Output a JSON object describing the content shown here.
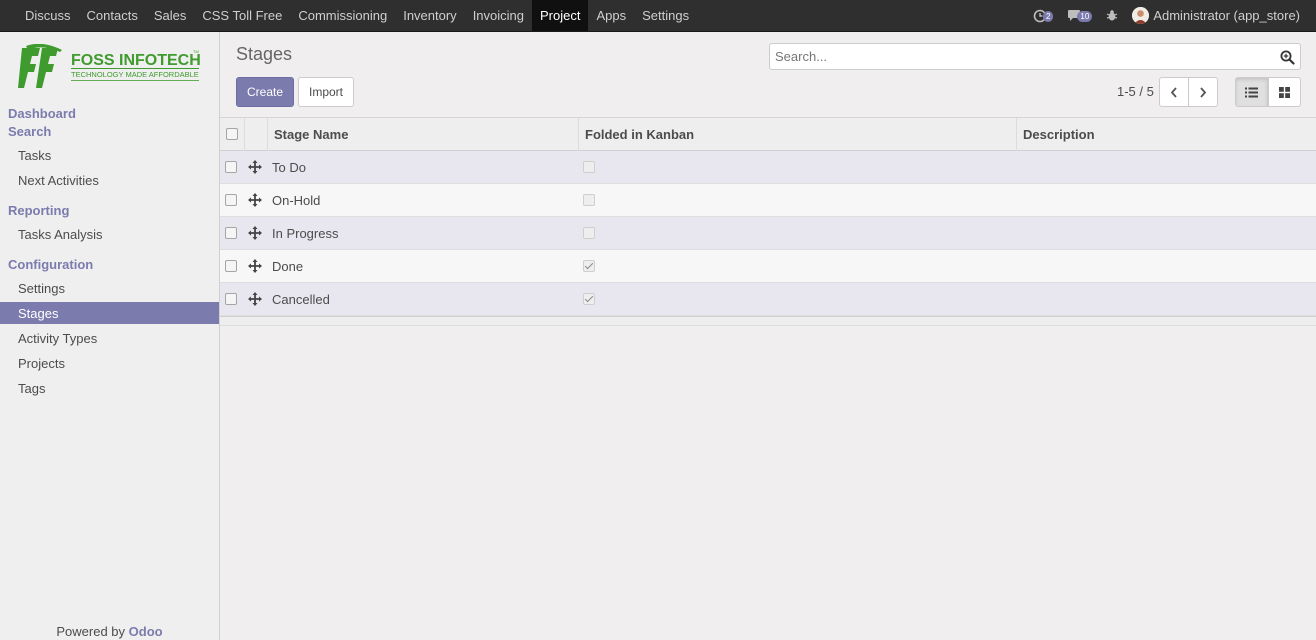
{
  "navbar": {
    "menus": [
      "Discuss",
      "Contacts",
      "Sales",
      "CSS Toll Free",
      "Commissioning",
      "Inventory",
      "Invoicing",
      "Project",
      "Apps",
      "Settings"
    ],
    "active_menu": "Project",
    "activity_count": "2",
    "message_count": "10",
    "user": "Administrator (app_store)"
  },
  "sidebar": {
    "logo_name": "FOSS INFOTECH",
    "logo_tagline": "TECHNOLOGY MADE AFFORDABLE",
    "logo_tm": "TM",
    "sections": [
      {
        "label": "Dashboard"
      },
      {
        "label": "Search",
        "items": [
          "Tasks",
          "Next Activities"
        ]
      },
      {
        "label": "Reporting",
        "items": [
          "Tasks Analysis"
        ]
      },
      {
        "label": "Configuration",
        "items": [
          "Settings",
          "Stages",
          "Activity Types",
          "Projects",
          "Tags"
        ]
      }
    ],
    "active_item": "Stages",
    "powered_prefix": "Powered by",
    "powered_brand": "Odoo"
  },
  "control_panel": {
    "title": "Stages",
    "search_placeholder": "Search...",
    "create_label": "Create",
    "import_label": "Import",
    "pager": "1-5 / 5",
    "active_view": "list"
  },
  "table": {
    "columns": [
      "Stage Name",
      "Folded in Kanban",
      "Description"
    ],
    "rows": [
      {
        "name": "To Do",
        "folded": false,
        "description": ""
      },
      {
        "name": "On-Hold",
        "folded": false,
        "description": ""
      },
      {
        "name": "In Progress",
        "folded": false,
        "description": ""
      },
      {
        "name": "Done",
        "folded": true,
        "description": ""
      },
      {
        "name": "Cancelled",
        "folded": true,
        "description": ""
      }
    ]
  },
  "colors": {
    "accent": "#7c7bad",
    "navbar_bg": "#2f2f2f",
    "logo_green": "#3f9b2d"
  }
}
